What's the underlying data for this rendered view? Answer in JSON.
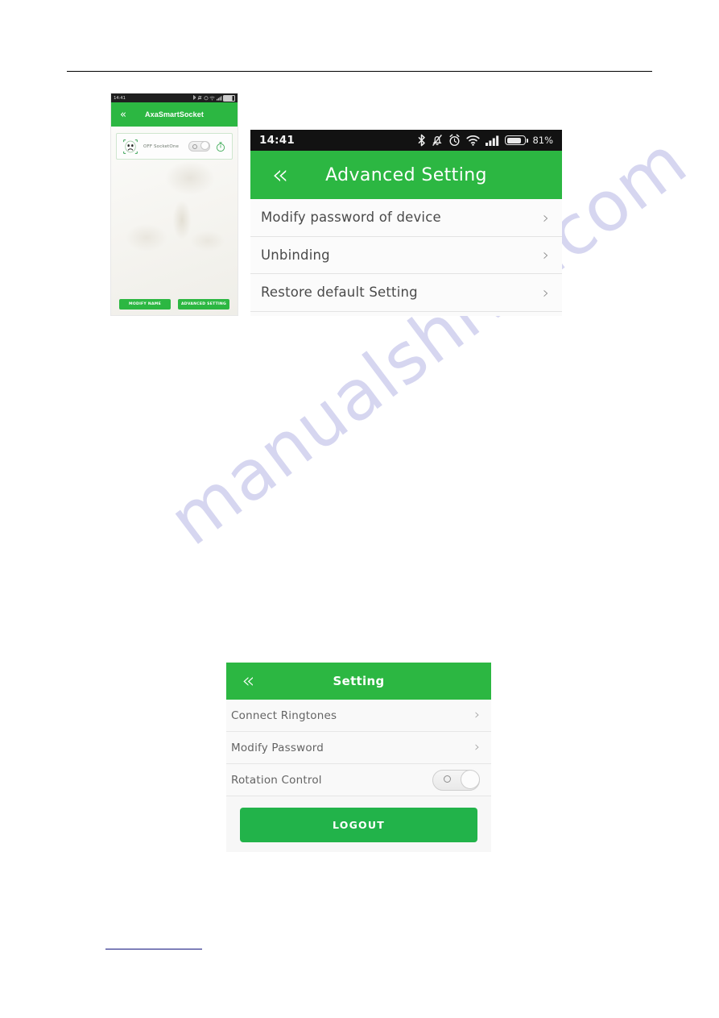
{
  "watermark": {
    "text": "manualshive.com"
  },
  "small_screen": {
    "status_bar": {
      "time": "14:41",
      "battery_percent": "81%",
      "icons": [
        "bluetooth-icon",
        "mute-icon",
        "alarm-icon",
        "wifi-icon",
        "signal-icon",
        "battery-icon"
      ]
    },
    "appbar": {
      "back_label": "«",
      "title": "AxaSmartSocket"
    },
    "device_card": {
      "face_icon": "sad-face-icon",
      "label": "OFF  SocketOne",
      "toggle_state": "off",
      "timer_icon": "stopwatch-icon"
    },
    "buttons": [
      {
        "label": "MODIFY NAME"
      },
      {
        "label": "ADVANCED SETTING"
      }
    ]
  },
  "advanced_screen": {
    "status_bar": {
      "time": "14:41",
      "battery_percent": "81%",
      "icons": [
        "bluetooth-icon",
        "mute-icon",
        "alarm-icon",
        "wifi-icon",
        "signal-icon",
        "battery-icon"
      ]
    },
    "appbar": {
      "back_label": "«",
      "title": "Advanced Setting"
    },
    "rows": [
      {
        "label": "Modify password of device",
        "arrow": "›"
      },
      {
        "label": "Unbinding",
        "arrow": "›"
      },
      {
        "label": "Restore default Setting",
        "arrow": "›"
      }
    ]
  },
  "setting_screen": {
    "appbar": {
      "back_label": "«",
      "title": "Setting"
    },
    "rows": [
      {
        "label": "Connect Ringtones",
        "type": "link",
        "arrow": "›"
      },
      {
        "label": "Modify Password",
        "type": "link",
        "arrow": "›"
      },
      {
        "label": "Rotation Control",
        "type": "toggle",
        "toggle_state": "off"
      }
    ],
    "logout_label": "LOGOUT"
  },
  "colors": {
    "brand_green": "#2cb742",
    "logout_green": "#22b34a",
    "status_bar_dark": "#121212",
    "link_blue": "#12147e",
    "watermark": "#cfd0ee"
  }
}
